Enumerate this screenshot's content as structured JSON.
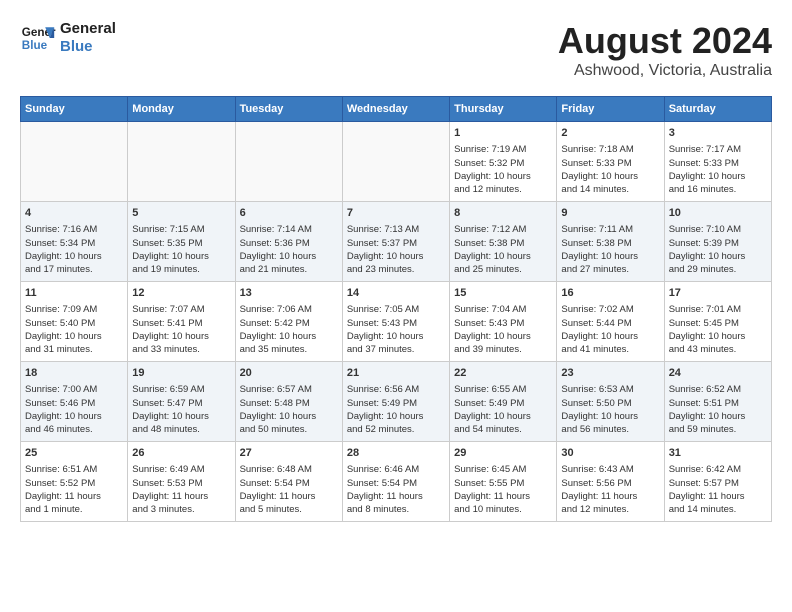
{
  "header": {
    "logo_line1": "General",
    "logo_line2": "Blue",
    "month_year": "August 2024",
    "location": "Ashwood, Victoria, Australia"
  },
  "days_of_week": [
    "Sunday",
    "Monday",
    "Tuesday",
    "Wednesday",
    "Thursday",
    "Friday",
    "Saturday"
  ],
  "weeks": [
    [
      {
        "day": "",
        "content": ""
      },
      {
        "day": "",
        "content": ""
      },
      {
        "day": "",
        "content": ""
      },
      {
        "day": "",
        "content": ""
      },
      {
        "day": "1",
        "content": "Sunrise: 7:19 AM\nSunset: 5:32 PM\nDaylight: 10 hours\nand 12 minutes."
      },
      {
        "day": "2",
        "content": "Sunrise: 7:18 AM\nSunset: 5:33 PM\nDaylight: 10 hours\nand 14 minutes."
      },
      {
        "day": "3",
        "content": "Sunrise: 7:17 AM\nSunset: 5:33 PM\nDaylight: 10 hours\nand 16 minutes."
      }
    ],
    [
      {
        "day": "4",
        "content": "Sunrise: 7:16 AM\nSunset: 5:34 PM\nDaylight: 10 hours\nand 17 minutes."
      },
      {
        "day": "5",
        "content": "Sunrise: 7:15 AM\nSunset: 5:35 PM\nDaylight: 10 hours\nand 19 minutes."
      },
      {
        "day": "6",
        "content": "Sunrise: 7:14 AM\nSunset: 5:36 PM\nDaylight: 10 hours\nand 21 minutes."
      },
      {
        "day": "7",
        "content": "Sunrise: 7:13 AM\nSunset: 5:37 PM\nDaylight: 10 hours\nand 23 minutes."
      },
      {
        "day": "8",
        "content": "Sunrise: 7:12 AM\nSunset: 5:38 PM\nDaylight: 10 hours\nand 25 minutes."
      },
      {
        "day": "9",
        "content": "Sunrise: 7:11 AM\nSunset: 5:38 PM\nDaylight: 10 hours\nand 27 minutes."
      },
      {
        "day": "10",
        "content": "Sunrise: 7:10 AM\nSunset: 5:39 PM\nDaylight: 10 hours\nand 29 minutes."
      }
    ],
    [
      {
        "day": "11",
        "content": "Sunrise: 7:09 AM\nSunset: 5:40 PM\nDaylight: 10 hours\nand 31 minutes."
      },
      {
        "day": "12",
        "content": "Sunrise: 7:07 AM\nSunset: 5:41 PM\nDaylight: 10 hours\nand 33 minutes."
      },
      {
        "day": "13",
        "content": "Sunrise: 7:06 AM\nSunset: 5:42 PM\nDaylight: 10 hours\nand 35 minutes."
      },
      {
        "day": "14",
        "content": "Sunrise: 7:05 AM\nSunset: 5:43 PM\nDaylight: 10 hours\nand 37 minutes."
      },
      {
        "day": "15",
        "content": "Sunrise: 7:04 AM\nSunset: 5:43 PM\nDaylight: 10 hours\nand 39 minutes."
      },
      {
        "day": "16",
        "content": "Sunrise: 7:02 AM\nSunset: 5:44 PM\nDaylight: 10 hours\nand 41 minutes."
      },
      {
        "day": "17",
        "content": "Sunrise: 7:01 AM\nSunset: 5:45 PM\nDaylight: 10 hours\nand 43 minutes."
      }
    ],
    [
      {
        "day": "18",
        "content": "Sunrise: 7:00 AM\nSunset: 5:46 PM\nDaylight: 10 hours\nand 46 minutes."
      },
      {
        "day": "19",
        "content": "Sunrise: 6:59 AM\nSunset: 5:47 PM\nDaylight: 10 hours\nand 48 minutes."
      },
      {
        "day": "20",
        "content": "Sunrise: 6:57 AM\nSunset: 5:48 PM\nDaylight: 10 hours\nand 50 minutes."
      },
      {
        "day": "21",
        "content": "Sunrise: 6:56 AM\nSunset: 5:49 PM\nDaylight: 10 hours\nand 52 minutes."
      },
      {
        "day": "22",
        "content": "Sunrise: 6:55 AM\nSunset: 5:49 PM\nDaylight: 10 hours\nand 54 minutes."
      },
      {
        "day": "23",
        "content": "Sunrise: 6:53 AM\nSunset: 5:50 PM\nDaylight: 10 hours\nand 56 minutes."
      },
      {
        "day": "24",
        "content": "Sunrise: 6:52 AM\nSunset: 5:51 PM\nDaylight: 10 hours\nand 59 minutes."
      }
    ],
    [
      {
        "day": "25",
        "content": "Sunrise: 6:51 AM\nSunset: 5:52 PM\nDaylight: 11 hours\nand 1 minute."
      },
      {
        "day": "26",
        "content": "Sunrise: 6:49 AM\nSunset: 5:53 PM\nDaylight: 11 hours\nand 3 minutes."
      },
      {
        "day": "27",
        "content": "Sunrise: 6:48 AM\nSunset: 5:54 PM\nDaylight: 11 hours\nand 5 minutes."
      },
      {
        "day": "28",
        "content": "Sunrise: 6:46 AM\nSunset: 5:54 PM\nDaylight: 11 hours\nand 8 minutes."
      },
      {
        "day": "29",
        "content": "Sunrise: 6:45 AM\nSunset: 5:55 PM\nDaylight: 11 hours\nand 10 minutes."
      },
      {
        "day": "30",
        "content": "Sunrise: 6:43 AM\nSunset: 5:56 PM\nDaylight: 11 hours\nand 12 minutes."
      },
      {
        "day": "31",
        "content": "Sunrise: 6:42 AM\nSunset: 5:57 PM\nDaylight: 11 hours\nand 14 minutes."
      }
    ]
  ]
}
